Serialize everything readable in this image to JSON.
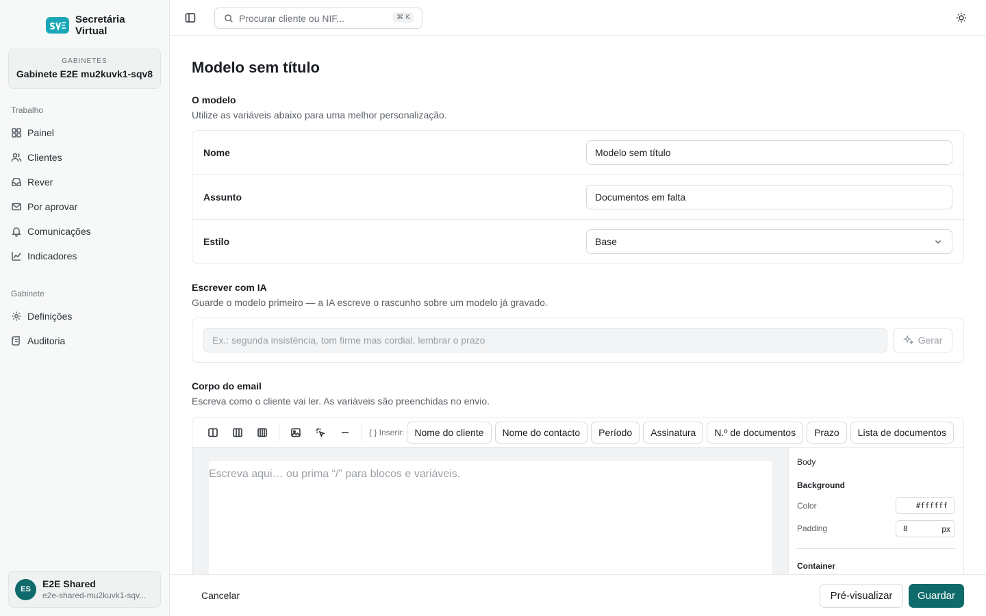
{
  "app": {
    "name_line1": "Secretária",
    "name_line2": "Virtual"
  },
  "workspace": {
    "label": "GABINETES",
    "name": "Gabinete E2E mu2kuvk1-sqv8"
  },
  "nav": {
    "section_work": "Trabalho",
    "work_items": [
      {
        "label": "Painel",
        "icon": "grid-icon"
      },
      {
        "label": "Clientes",
        "icon": "users-icon"
      },
      {
        "label": "Rever",
        "icon": "inbox-icon"
      },
      {
        "label": "Por aprovar",
        "icon": "mail-icon"
      },
      {
        "label": "Comunicações",
        "icon": "bell-icon"
      },
      {
        "label": "Indicadores",
        "icon": "chart-icon"
      }
    ],
    "section_office": "Gabinete",
    "office_items": [
      {
        "label": "Definições",
        "icon": "gear-icon"
      },
      {
        "label": "Auditoria",
        "icon": "scroll-icon"
      }
    ]
  },
  "user": {
    "initials": "ES",
    "name": "E2E Shared",
    "email": "e2e-shared-mu2kuvk1-sqv..."
  },
  "search": {
    "placeholder": "Procurar cliente ou NIF...",
    "shortcut": "⌘ K"
  },
  "page": {
    "title": "Modelo sem título"
  },
  "model_section": {
    "heading": "O modelo",
    "subtitle": "Utilize as variáveis abaixo para uma melhor personalização.",
    "name_label": "Nome",
    "name_value": "Modelo sem título",
    "subject_label": "Assunto",
    "subject_value": "Documentos em falta",
    "style_label": "Estilo",
    "style_value": "Base"
  },
  "ai_section": {
    "heading": "Escrever com IA",
    "subtitle": "Guarde o modelo primeiro — a IA escreve o rascunho sobre um modelo já gravado.",
    "placeholder": "Ex.: segunda insistência, tom firme mas cordial, lembrar o prazo",
    "generate_label": "Gerar"
  },
  "body_section": {
    "heading": "Corpo do email",
    "subtitle": "Escreva como o cliente vai ler. As variáveis são preenchidas no envio.",
    "insert_label": "{ } Inserir:",
    "variables": [
      "Nome do cliente",
      "Nome do contacto",
      "Período",
      "Assinatura",
      "N.º de documentos",
      "Prazo",
      "Lista de documentos"
    ],
    "editor_placeholder": "Escreva aqui… ou prima “/” para blocos e variáveis."
  },
  "properties": {
    "body_label": "Body",
    "background_heading": "Background",
    "color_label": "Color",
    "color_value": "#ffffff",
    "padding_label": "Padding",
    "padding_value": "8",
    "padding_unit": "px",
    "container_heading": "Container"
  },
  "footer": {
    "cancel_label": "Cancelar",
    "preview_label": "Pré-visualizar",
    "save_label": "Guardar"
  },
  "colors": {
    "accent": "#0f6b6b",
    "logo": "#1aa8b8"
  }
}
